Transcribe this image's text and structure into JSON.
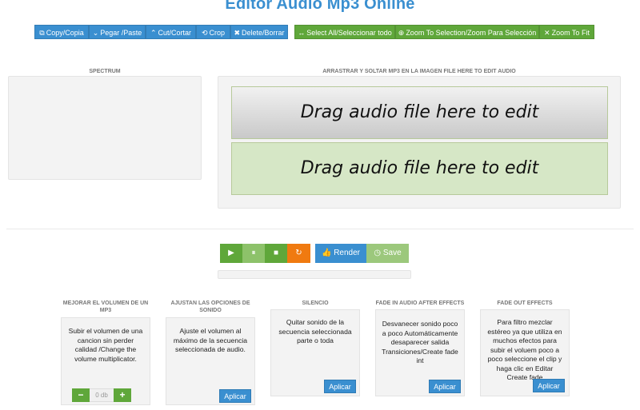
{
  "app": {
    "title": "Editor Audio Mp3 Online"
  },
  "toolbar": {
    "copy": "Copy/Copia",
    "paste": "Pegar /Paste",
    "cut": "Cut/Cortar",
    "crop": "Crop",
    "delete": "Delete/Borrar",
    "select_all": "Select All/Seleccionar todo",
    "zoom_selection": "Zoom To Selection/Zoom Para Selección",
    "zoom_fit": "Zoom To Fit"
  },
  "spectrum": {
    "label": "SPECTRUM"
  },
  "editor": {
    "label": "ARRASTRAR Y SOLTAR MP3 EN LA IMAGEN FILE HERE TO EDIT AUDIO",
    "drop_text_1": "Drag audio file here to edit",
    "drop_text_2": "Drag audio file here to edit"
  },
  "player": {
    "render_label": "Render",
    "save_label": "Save"
  },
  "effects": [
    {
      "title": "MEJORAR EL VOLUMEN DE UN MP3",
      "text": "Subir el volumen de una cancion sin perder calidad /Change the volume multiplicator.",
      "volume_value": "0 db"
    },
    {
      "title": "AJUSTAN LAS OPCIONES DE SONIDO",
      "text": "Ajuste el volumen al máximo de la secuencia seleccionada de audio.",
      "button": "Aplicar"
    },
    {
      "title": "SILENCIO",
      "text": "Quitar sonido de la secuencia seleccionada parte o toda",
      "button": "Aplicar"
    },
    {
      "title": "FADE IN AUDIO AFTER EFFECTS",
      "text": "Desvanecer sonido poco a poco Automáticamente desaparecer salida Transiciones/Create fade int",
      "button": "Aplicar"
    },
    {
      "title": "FADE OUT EFFECTS",
      "text": "Para filtro mezclar estéreo ya que utiliza en muchos efectos para subir el voluem poco a poco seleccione el clip y haga clic en Editar Create fade",
      "button": "Aplicar"
    }
  ],
  "colors": {
    "primary": "#3a8fd0",
    "success": "#5fa73a",
    "warning": "#f07a10"
  },
  "icons": {
    "copy": "copy-icon",
    "paste": "chevron-down-icon",
    "cut": "chevron-up-icon",
    "crop": "crop-icon",
    "delete": "close-icon",
    "select_all": "arrows-horizontal-icon",
    "zoom_selection": "plus-circle-icon",
    "zoom_fit": "expand-icon",
    "play": "play-icon",
    "pause": "pause-icon",
    "stop": "stop-icon",
    "reload": "reload-icon",
    "render": "thumb-icon",
    "save": "clock-icon"
  }
}
